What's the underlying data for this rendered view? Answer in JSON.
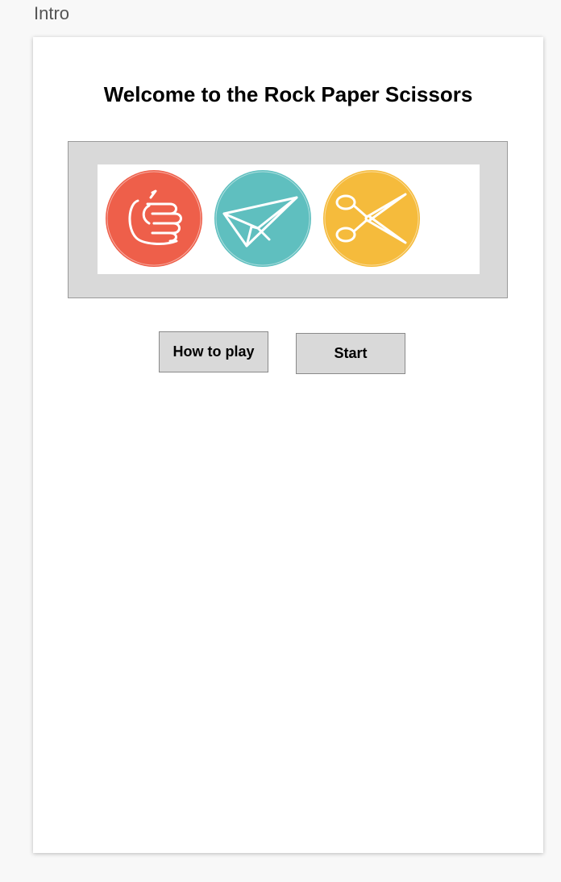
{
  "screen": {
    "label": "Intro"
  },
  "page": {
    "title": "Welcome to the Rock Paper Scissors"
  },
  "image": {
    "icons": [
      "rock-fist-icon",
      "paper-plane-icon",
      "scissors-icon"
    ],
    "colors": {
      "rock": "#ee5f4a",
      "paper": "#5fbfbf",
      "scissors": "#f5bb3c",
      "panel": "#d9d9d9"
    }
  },
  "buttons": {
    "how_to_play": "How to play",
    "start": "Start"
  }
}
